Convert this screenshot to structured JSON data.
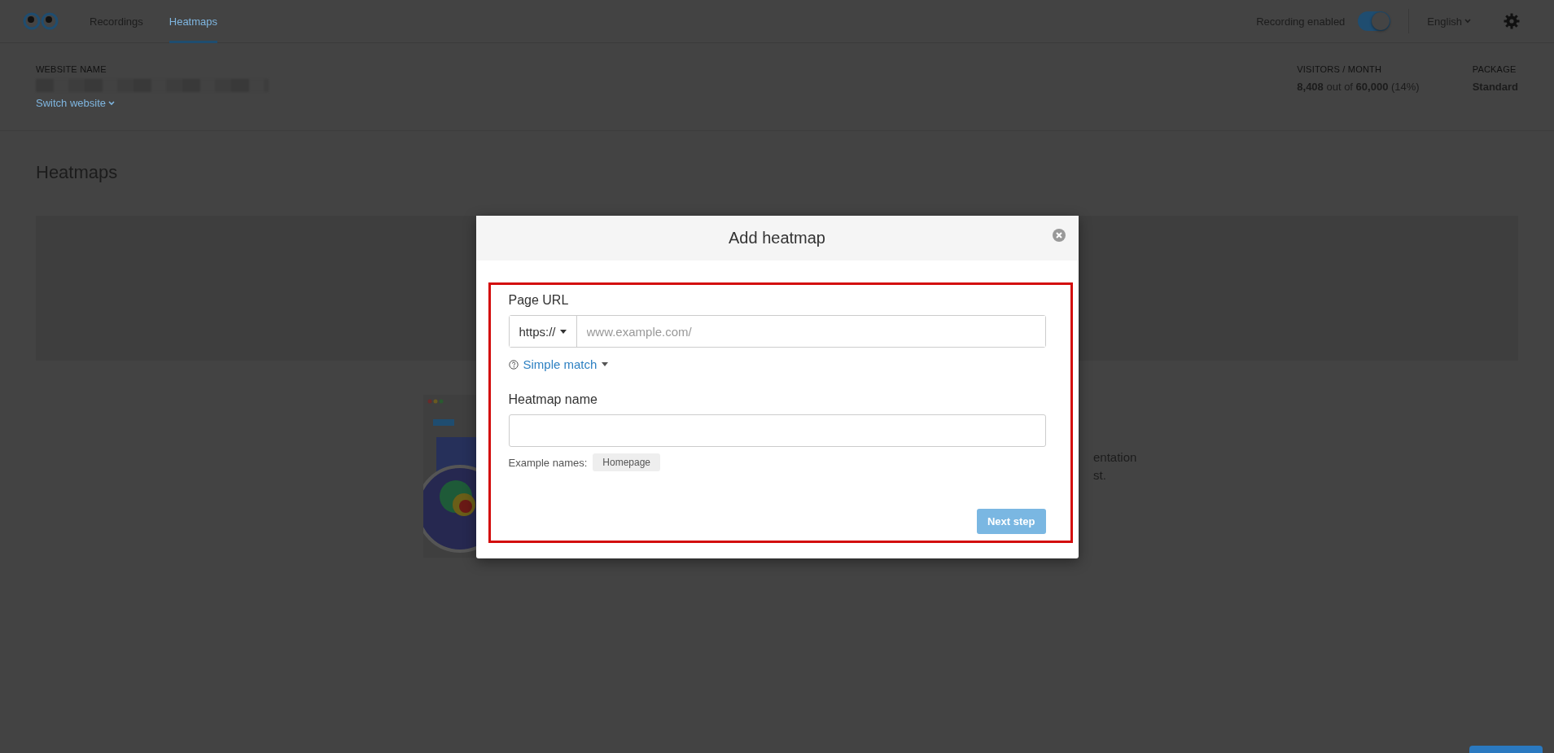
{
  "nav": {
    "tabs": [
      {
        "label": "Recordings",
        "selected": false
      },
      {
        "label": "Heatmaps",
        "selected": true
      }
    ],
    "recording": {
      "label": "Recording enabled",
      "on": true
    },
    "language": "English"
  },
  "site": {
    "label": "WEBSITE NAME",
    "switch": "Switch website",
    "visitors": {
      "label": "VISITORS / MONTH",
      "value": "**8,408** out of **60,000** (14%)"
    },
    "package": {
      "label": "PACKAGE",
      "value": "Standard"
    }
  },
  "page": {
    "title": "Heatmaps",
    "fragments": [
      "entation",
      "st."
    ]
  },
  "modal": {
    "title": "Add heatmap",
    "url_label": "Page URL",
    "protocol": "https://",
    "url": {
      "placeholder": "www.example.com/"
    },
    "match": "Simple match",
    "name_label": "Heatmap name",
    "examples_label": "Example names:",
    "examples": [
      "Homepage"
    ],
    "next": {
      "label": "Next step",
      "disabled": true
    }
  }
}
